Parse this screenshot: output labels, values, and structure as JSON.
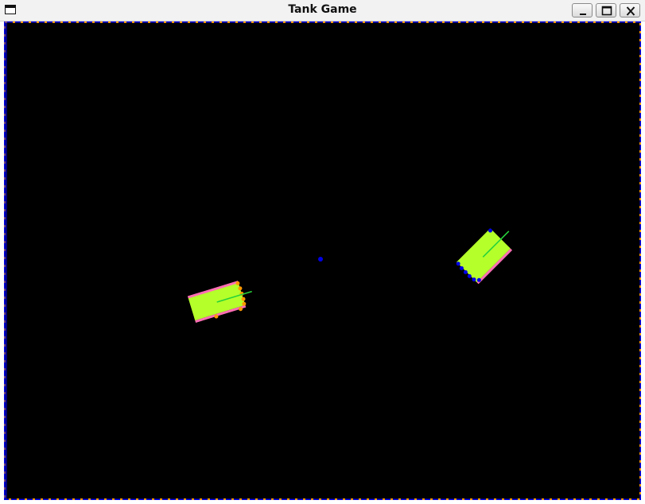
{
  "window": {
    "title": "Tank Game",
    "buttons": [
      "minimize",
      "maximize",
      "close"
    ]
  },
  "colors": {
    "background": "#000000",
    "tank_body": "#b5ff2a",
    "tank_stripe": "#ff6fb5",
    "barrel": "#27d23b",
    "tank1_marker": "#ff9a00",
    "tank2_marker": "#0000e6",
    "bullet": "#0000e6",
    "border_primary": "#ff9a00",
    "border_secondary": "#0000e6"
  },
  "scene": {
    "tanks": [
      {
        "id": "tank-1",
        "heading_deg": -17,
        "marker_color": "orange"
      },
      {
        "id": "tank-2",
        "heading_deg": -45,
        "marker_color": "blue"
      }
    ],
    "projectiles": [
      {
        "id": "bullet-1",
        "color": "blue"
      }
    ]
  }
}
